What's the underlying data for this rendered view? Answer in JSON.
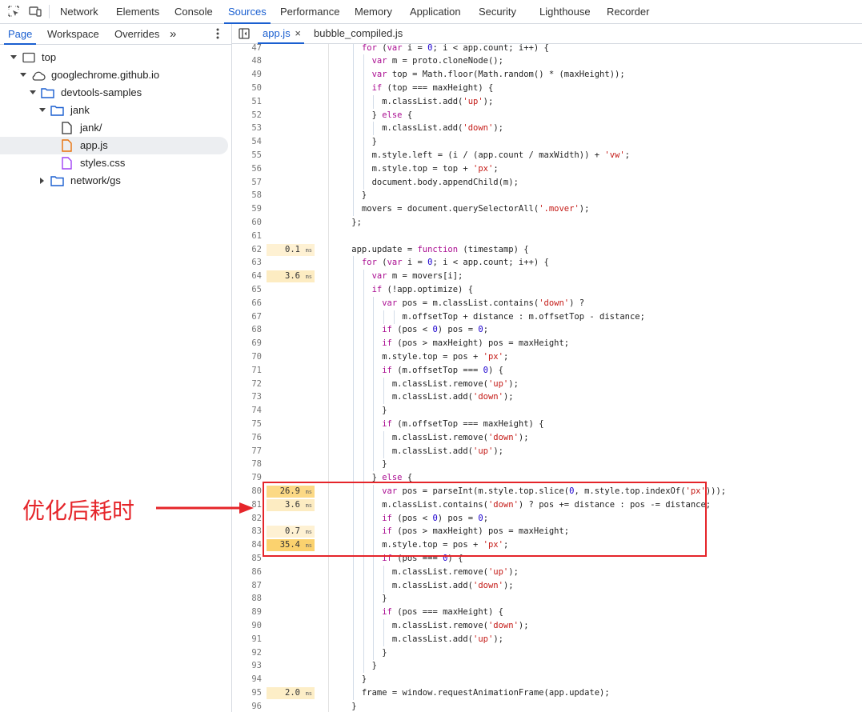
{
  "toolbar": {
    "tabs": [
      "Network",
      "Elements",
      "Console",
      "Sources",
      "Performance",
      "Memory",
      "Application",
      "Security",
      "Lighthouse",
      "Recorder"
    ],
    "active_tab": "Sources"
  },
  "navigator": {
    "tabs": [
      "Page",
      "Workspace",
      "Overrides"
    ],
    "more": "»",
    "tree": [
      {
        "label": "top"
      },
      {
        "label": "googlechrome.github.io"
      },
      {
        "label": "devtools-samples"
      },
      {
        "label": "jank"
      },
      {
        "label": "jank/"
      },
      {
        "label": "app.js"
      },
      {
        "label": "styles.css"
      },
      {
        "label": "network/gs"
      }
    ]
  },
  "editor": {
    "tabs": [
      {
        "label": "app.js",
        "close": "×"
      },
      {
        "label": "bubble_compiled.js"
      }
    ],
    "lines": [
      {
        "n": "47",
        "t": "      for (var i = 0; i < app.count; i++) {"
      },
      {
        "n": "48",
        "t": "        var m = proto.cloneNode();"
      },
      {
        "n": "49",
        "t": "        var top = Math.floor(Math.random() * (maxHeight));"
      },
      {
        "n": "50",
        "t": "        if (top === maxHeight) {"
      },
      {
        "n": "51",
        "t": "          m.classList.add('up');"
      },
      {
        "n": "52",
        "t": "        } else {"
      },
      {
        "n": "53",
        "t": "          m.classList.add('down');"
      },
      {
        "n": "54",
        "t": "        }"
      },
      {
        "n": "55",
        "t": "        m.style.left = (i / (app.count / maxWidth)) + 'vw';"
      },
      {
        "n": "56",
        "t": "        m.style.top = top + 'px';"
      },
      {
        "n": "57",
        "t": "        document.body.appendChild(m);"
      },
      {
        "n": "58",
        "t": "      }"
      },
      {
        "n": "59",
        "t": "      movers = document.querySelectorAll('.mover');"
      },
      {
        "n": "60",
        "t": "    };"
      },
      {
        "n": "61",
        "t": ""
      },
      {
        "n": "62",
        "t": "    app.update = function (timestamp) {",
        "p": "0.1"
      },
      {
        "n": "63",
        "t": "      for (var i = 0; i < app.count; i++) {"
      },
      {
        "n": "64",
        "t": "        var m = movers[i];",
        "p": "3.6"
      },
      {
        "n": "65",
        "t": "        if (!app.optimize) {"
      },
      {
        "n": "66",
        "t": "          var pos = m.classList.contains('down') ?"
      },
      {
        "n": "67",
        "t": "              m.offsetTop + distance : m.offsetTop - distance;"
      },
      {
        "n": "68",
        "t": "          if (pos < 0) pos = 0;"
      },
      {
        "n": "69",
        "t": "          if (pos > maxHeight) pos = maxHeight;"
      },
      {
        "n": "70",
        "t": "          m.style.top = pos + 'px';"
      },
      {
        "n": "71",
        "t": "          if (m.offsetTop === 0) {"
      },
      {
        "n": "72",
        "t": "            m.classList.remove('up');"
      },
      {
        "n": "73",
        "t": "            m.classList.add('down');"
      },
      {
        "n": "74",
        "t": "          }"
      },
      {
        "n": "75",
        "t": "          if (m.offsetTop === maxHeight) {"
      },
      {
        "n": "76",
        "t": "            m.classList.remove('down');"
      },
      {
        "n": "77",
        "t": "            m.classList.add('up');"
      },
      {
        "n": "78",
        "t": "          }"
      },
      {
        "n": "79",
        "t": "        } else {"
      },
      {
        "n": "80",
        "t": "          var pos = parseInt(m.style.top.slice(0, m.style.top.indexOf('px')));",
        "p": "26.9"
      },
      {
        "n": "81",
        "t": "          m.classList.contains('down') ? pos += distance : pos -= distance;",
        "p": "3.6"
      },
      {
        "n": "82",
        "t": "          if (pos < 0) pos = 0;"
      },
      {
        "n": "83",
        "t": "          if (pos > maxHeight) pos = maxHeight;",
        "p": "0.7"
      },
      {
        "n": "84",
        "t": "          m.style.top = pos + 'px';",
        "p": "35.4"
      },
      {
        "n": "85",
        "t": "          if (pos === 0) {"
      },
      {
        "n": "86",
        "t": "            m.classList.remove('up');"
      },
      {
        "n": "87",
        "t": "            m.classList.add('down');"
      },
      {
        "n": "88",
        "t": "          }"
      },
      {
        "n": "89",
        "t": "          if (pos === maxHeight) {"
      },
      {
        "n": "90",
        "t": "            m.classList.remove('down');"
      },
      {
        "n": "91",
        "t": "            m.classList.add('up');"
      },
      {
        "n": "92",
        "t": "          }"
      },
      {
        "n": "93",
        "t": "        }"
      },
      {
        "n": "94",
        "t": "      }"
      },
      {
        "n": "95",
        "t": "      frame = window.requestAnimationFrame(app.update);",
        "p": "2.0"
      },
      {
        "n": "96",
        "t": "    }"
      }
    ],
    "profile_unit": "ms"
  },
  "annotation": {
    "text": "优化后耗时",
    "color": "#e5252a"
  },
  "colors": {
    "accent": "#1a5fd0",
    "profile_bar": "#fbd982",
    "keyword": "#aa0d91",
    "string": "#c41a16",
    "number": "#1c00cf"
  }
}
